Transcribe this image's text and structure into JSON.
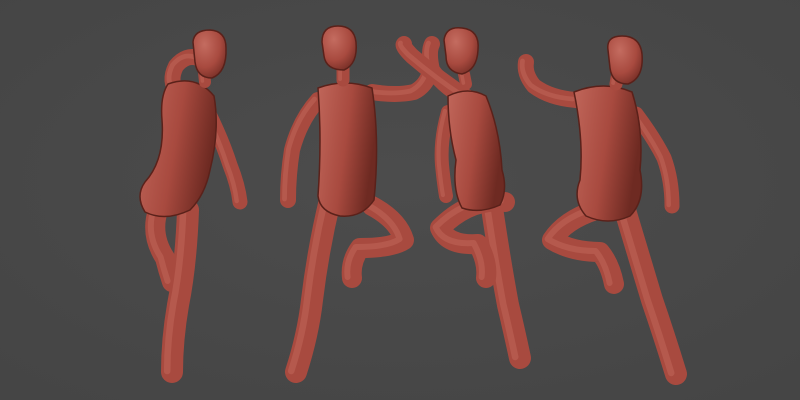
{
  "viewport": {
    "background_color": "#454545",
    "background_highlight": "#4c4c4c"
  },
  "figures": [
    {
      "view": "back",
      "icon": "mannequin-back-view-icon"
    },
    {
      "view": "front",
      "icon": "mannequin-front-view-icon"
    },
    {
      "view": "side",
      "icon": "mannequin-side-view-icon"
    },
    {
      "view": "back-three-quarter",
      "icon": "mannequin-back-quarter-view-icon"
    }
  ],
  "material": {
    "base_color": "#a84a3f",
    "light_color": "#c0665a",
    "shadow_color": "#6e2a22",
    "outline_color": "#5a211a"
  }
}
